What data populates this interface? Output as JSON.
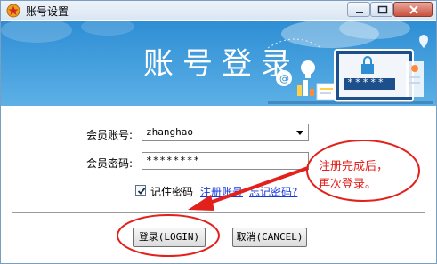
{
  "window": {
    "title": "账号设置",
    "icons": {
      "app": "star-badge-icon",
      "minimize": "minimize-icon",
      "maximize": "maximize-icon",
      "close": "close-icon"
    }
  },
  "banner": {
    "title": "账号登录",
    "password_mask": "*****",
    "colors": {
      "top": "#2e8ed4",
      "bottom": "#5cb0e6"
    }
  },
  "form": {
    "account_label": "会员账号:",
    "account_value": "zhanghao",
    "password_label": "会员密码:",
    "password_value": "********",
    "remember_label": "记住密码",
    "remember_checked": true,
    "register_link": "注册账号",
    "forgot_link": "忘记密码?"
  },
  "buttons": {
    "login": "登录(LOGIN)",
    "cancel": "取消(CANCEL)"
  },
  "annotation": {
    "line1": "注册完成后，",
    "line2": "再次登录。",
    "color": "#e2211c"
  }
}
